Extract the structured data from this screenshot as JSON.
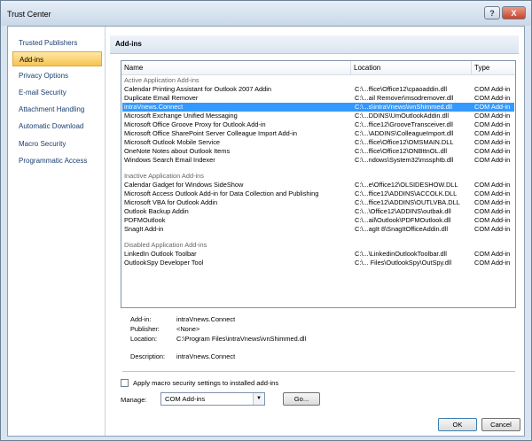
{
  "window": {
    "title": "Trust Center",
    "help_label": "?",
    "close_label": "X"
  },
  "sidebar": {
    "items": [
      {
        "label": "Trusted Publishers"
      },
      {
        "label": "Add-ins"
      },
      {
        "label": "Privacy Options"
      },
      {
        "label": "E-mail Security"
      },
      {
        "label": "Attachment Handling"
      },
      {
        "label": "Automatic Download"
      },
      {
        "label": "Macro Security"
      },
      {
        "label": "Programmatic Access"
      }
    ],
    "active_index": 1
  },
  "main": {
    "section_title": "Add-ins",
    "columns": {
      "name": "Name",
      "location": "Location",
      "type": "Type"
    },
    "groups": [
      {
        "title": "Active Application Add-ins",
        "rows": [
          {
            "name": "Calendar Printing Assistant for Outlook 2007 Addin",
            "location": "C:\\...ffice\\Office12\\cpaoaddin.dll",
            "type": "COM Add-in"
          },
          {
            "name": "Duplicate Email Remover",
            "location": "C:\\...ail Remover\\msodremover.dll",
            "type": "COM Add-in"
          },
          {
            "name": "intraVnews.Connect",
            "location": "C:\\...s\\intraVnews\\ivnShimmed.dll",
            "type": "COM Add-in",
            "selected": true
          },
          {
            "name": "Microsoft Exchange Unified Messaging",
            "location": "C:\\...DDINS\\UmOutlookAddin.dll",
            "type": "COM Add-in"
          },
          {
            "name": "Microsoft Office Groove Proxy for Outlook Add-in",
            "location": "C:\\...ffice12\\GrooveTransceiver.dll",
            "type": "COM Add-in"
          },
          {
            "name": "Microsoft Office SharePoint Server Colleague Import Add-in",
            "location": "C:\\...\\ADDINS\\ColleagueImport.dll",
            "type": "COM Add-in"
          },
          {
            "name": "Microsoft Outlook Mobile Service",
            "location": "C:\\...ffice\\Office12\\OMSMAIN.DLL",
            "type": "COM Add-in"
          },
          {
            "name": "OneNote Notes about Outlook Items",
            "location": "C:\\...ffice\\Office12\\ONBttnOL.dll",
            "type": "COM Add-in"
          },
          {
            "name": "Windows Search Email Indexer",
            "location": "C:\\...ndows\\System32\\mssphtb.dll",
            "type": "COM Add-in"
          }
        ]
      },
      {
        "title": "Inactive Application Add-ins",
        "rows": [
          {
            "name": "Calendar Gadget for Windows SideShow",
            "location": "C:\\...e\\Office12\\OLSIDESHOW.DLL",
            "type": "COM Add-in"
          },
          {
            "name": "Microsoft Access Outlook Add-in for Data Collection and Publishing",
            "location": "C:\\...ffice12\\ADDINS\\ACCOLK.DLL",
            "type": "COM Add-in"
          },
          {
            "name": "Microsoft VBA for Outlook Addin",
            "location": "C:\\...ffice12\\ADDINS\\OUTLVBA.DLL",
            "type": "COM Add-in"
          },
          {
            "name": "Outlook Backup Addin",
            "location": "C:\\...\\Office12\\ADDINS\\outbak.dll",
            "type": "COM Add-in"
          },
          {
            "name": "PDFMOutlook",
            "location": "C:\\...ail\\Outlook\\PDFMOutlook.dll",
            "type": "COM Add-in"
          },
          {
            "name": "SnagIt Add-in",
            "location": "C:\\...agIt 8\\SnagItOfficeAddin.dll",
            "type": "COM Add-in"
          }
        ]
      },
      {
        "title": "Disabled Application Add-ins",
        "rows": [
          {
            "name": "LinkedIn Outlook Toolbar",
            "location": "C:\\...\\LinkedinOutlookToolbar.dll",
            "type": "COM Add-in"
          },
          {
            "name": "OutlookSpy Developer Tool",
            "location": "C:\\... Files\\OutlookSpy\\OutSpy.dll",
            "type": "COM Add-in"
          }
        ]
      }
    ],
    "details": {
      "addin_label": "Add-in:",
      "addin_value": "intraVnews.Connect",
      "publisher_label": "Publisher:",
      "publisher_value": "<None>",
      "location_label": "Location:",
      "location_value": "C:\\Program Files\\intraVnews\\ivnShimmed.dll",
      "description_label": "Description:",
      "description_value": "intraVnews.Connect"
    },
    "macro_checkbox_label": "Apply macro security settings to installed add-ins",
    "macro_checkbox_checked": false,
    "manage_label": "Manage:",
    "manage_value": "COM Add-ins",
    "go_label": "Go..."
  },
  "footer": {
    "ok_label": "OK",
    "cancel_label": "Cancel"
  },
  "colors": {
    "selection": "#3399ff",
    "active_nav": "#f7c34f",
    "close_button": "#c8432a"
  }
}
